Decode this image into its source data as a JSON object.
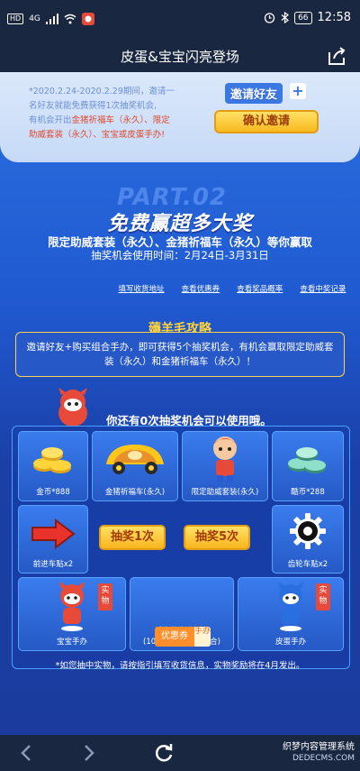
{
  "status_bar": {
    "network": "4G",
    "battery": "66",
    "time": "12:58"
  },
  "header": {
    "title": "皮蛋&宝宝闪亮登场"
  },
  "invite": {
    "text_line1": "*2020.2.24-2020.2.29期间，邀请一",
    "text_line2": "名好友就能免费获得1次抽奖机会,",
    "text_line3_a": "有机会开出",
    "text_line3_b": "金猪祈福车（永久）、限定",
    "text_line4": "助威套装（永久）、宝宝或皮蛋手办!",
    "friend_label": "邀请好友",
    "confirm_label": "确认邀请"
  },
  "hero": {
    "part_text": "PART.02",
    "headline": "免费赢超多大奖",
    "sub1": "限定助威套装（永久）、金猪祈福车（永久）等你赢取",
    "sub2": "抽奖机会使用时间：2月24日-3月31日"
  },
  "links": [
    "填写收货地址",
    "查看优惠券",
    "查看奖品概率",
    "查看中奖记录"
  ],
  "strategy": {
    "title": "薅羊毛攻略",
    "text": "邀请好友+购买组合手办，即可获得5个抽奖机会，有机会赢取限定助威套装（永久）和金猪祈福车（永久）！"
  },
  "chances_text": "你还有0次抽奖机会可以使用哦。",
  "prizes": {
    "gold": "金币*888",
    "pig_car": "金猪祈福车(永久)",
    "cheer_suit": "限定助威套装(永久)",
    "cool_coin": "酷币*288",
    "forward_sticker": "前进车贴x2",
    "gear_sticker": "齿轮车贴x2",
    "baobao_figure": "宝宝手办",
    "coupon_combo_line1": "手办优惠券组合",
    "coupon_combo_line2": "(10元单只&20元组合)",
    "pidan_figure": "皮蛋手办",
    "tag_real": "实物",
    "coupon_main": "优惠券",
    "coupon_side": "手办"
  },
  "buttons": {
    "draw_once": "抽奖1次",
    "draw_five": "抽奖5次"
  },
  "footnote": "*如您抽中实物，请按指引填写收货信息，实物奖励将在4月发出。",
  "watermark": {
    "line1": "织梦内容管理系统",
    "line2": "DEDECMS.COM"
  },
  "colors": {
    "accent_yellow": "#ffd43b",
    "button_gold": "#f9b921",
    "primary_blue": "#2a6fe0",
    "highlight_red": "#e04a2d"
  }
}
